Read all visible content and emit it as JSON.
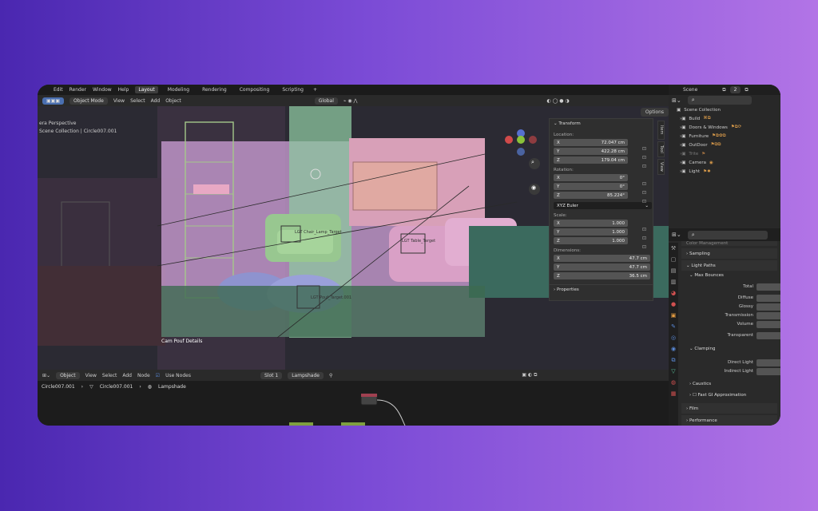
{
  "top_menu": {
    "items": [
      "Edit",
      "Render",
      "Window",
      "Help"
    ],
    "workspaces": [
      "Layout",
      "Modeling",
      "Rendering",
      "Compositing",
      "Scripting"
    ],
    "add_workspace": "+"
  },
  "viewport_header": {
    "mode": "Object Mode",
    "menus": [
      "View",
      "Select",
      "Add",
      "Object"
    ],
    "orientation": "Global",
    "options": "Options"
  },
  "viewport": {
    "camera_label": "era Perspective",
    "collection_label": "Scene Collection | Circle007.001",
    "caption": "Cam Pouf Details",
    "objects": [
      "LGT Chair_Lamp_Target",
      "LGT Table_Target",
      "LGT Pouf_Target.001"
    ]
  },
  "side_tabs": [
    "Item",
    "Tool",
    "View"
  ],
  "transform": {
    "title": "Transform",
    "location_label": "Location:",
    "location": [
      {
        "axis": "X",
        "value": "72.047 cm"
      },
      {
        "axis": "Y",
        "value": "422.28 cm"
      },
      {
        "axis": "Z",
        "value": "179.04 cm"
      }
    ],
    "rotation_label": "Rotation:",
    "rotation": [
      {
        "axis": "X",
        "value": "0°"
      },
      {
        "axis": "Y",
        "value": "0°"
      },
      {
        "axis": "Z",
        "value": "85.224°"
      }
    ],
    "rotation_mode": "XYZ Euler",
    "scale_label": "Scale:",
    "scale": [
      {
        "axis": "X",
        "value": "1.000"
      },
      {
        "axis": "Y",
        "value": "1.000"
      },
      {
        "axis": "Z",
        "value": "1.000"
      }
    ],
    "dimensions_label": "Dimensions:",
    "dimensions": [
      {
        "axis": "X",
        "value": "47.7 cm"
      },
      {
        "axis": "Y",
        "value": "47.7 cm"
      },
      {
        "axis": "Z",
        "value": "36.5 cm"
      }
    ],
    "properties": "Properties"
  },
  "outliner": {
    "scene": "Scene",
    "scene_count": "2",
    "root": "Scene Collection",
    "items": [
      "Build",
      "Doors & Windows",
      "Furniture",
      "OutDoor",
      "Trite",
      "Camera",
      "Light"
    ]
  },
  "properties": {
    "sections": [
      "Sampling",
      "Light Paths",
      "Film",
      "Performance"
    ],
    "max_bounces": "Max Bounces",
    "bounces": [
      "Total",
      "Diffuse",
      "Glossy",
      "Transmission",
      "Volume",
      "Transparent"
    ],
    "clamping": "Clamping",
    "clamping_fields": [
      "Direct Light",
      "Indirect Light"
    ],
    "caustics": "Caustics",
    "fast_gi": "Fast GI Approximation",
    "color_management": "Color Management"
  },
  "node_editor": {
    "type": "Object",
    "menus": [
      "View",
      "Select",
      "Add",
      "Node"
    ],
    "use_nodes": "Use Nodes",
    "slot": "Slot 1",
    "material": "Lampshade",
    "breadcrumb": [
      "Circle007.001",
      "Circle007.001",
      "Lampshade"
    ]
  }
}
